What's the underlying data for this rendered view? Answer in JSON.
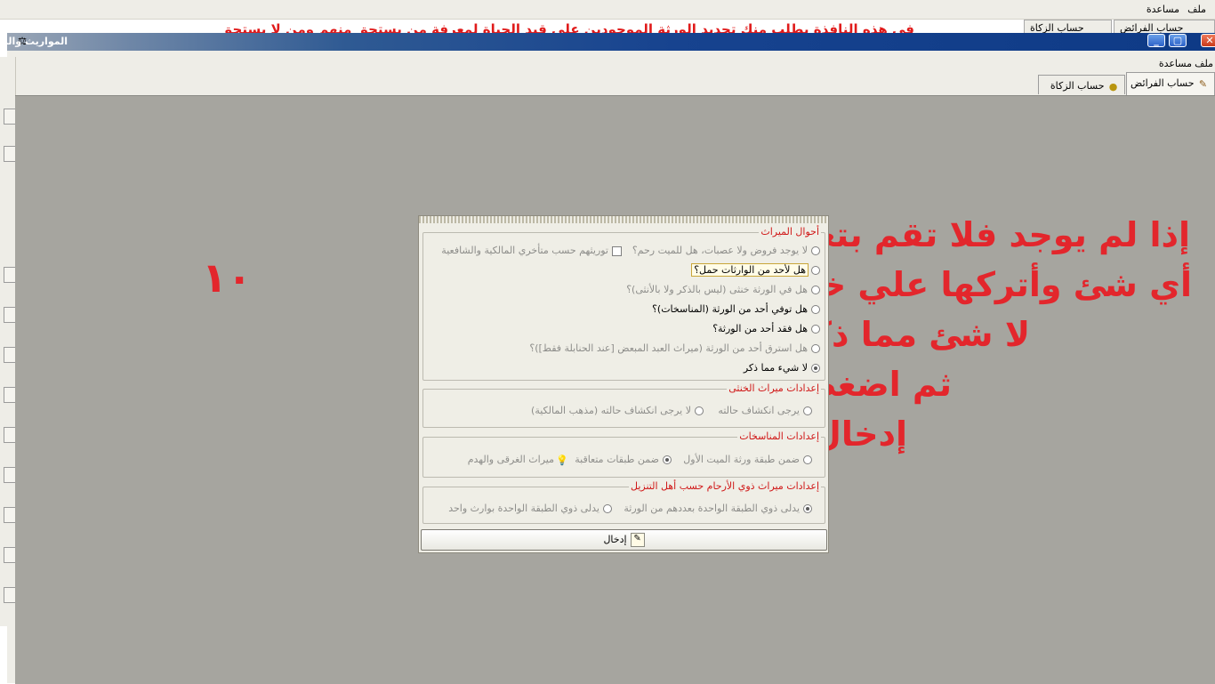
{
  "background_window": {
    "menu": {
      "file": "ملف",
      "help": "مساعدة"
    },
    "instruction_text": "في هذه النافذة يطلب منك تحديد الورثة الموجودين على قيد الحياة لمعرفة من يستحق منهم ومن لا يستحق",
    "tabs": {
      "fara": "حساب الفرائض",
      "zakat": "حساب الزكاة"
    }
  },
  "window": {
    "title": "المواريث والزكاة",
    "menu": {
      "file": "ملف",
      "help": "مساعدة"
    },
    "tabs": [
      {
        "label": "حساب الفرائض",
        "icon": "broom-icon",
        "active": true
      },
      {
        "label": "حساب الزكاة",
        "icon": "money-bag-icon",
        "active": false
      }
    ]
  },
  "annotation": {
    "step_number": "١٠",
    "lines": [
      "إذا لم يوجد فلا تقم بتعديل",
      "أي شئ وأتركها علي خير",
      "لا شئ مما ذكر",
      "ثم اضغط",
      "إدخال"
    ],
    "color": "#e3262c"
  },
  "dialog": {
    "heirs_group": {
      "legend": "أحوال الميراث",
      "options": [
        {
          "label": "لا يوجد فروض ولا عصبات، هل للميت رحم؟",
          "enabled": false,
          "selected": false
        },
        {
          "label": "هل لأحد من الوارثات حمل؟",
          "enabled": true,
          "selected": false,
          "focused": true
        },
        {
          "label": "هل في الورثة خنثى (ليس بالذكر ولا بالأنثى)؟",
          "enabled": false,
          "selected": false
        },
        {
          "label": "هل توفي أحد من الورثة (المناسخات)؟",
          "enabled": true,
          "selected": false
        },
        {
          "label": "هل فقد أحد من الورثة؟",
          "enabled": true,
          "selected": false
        },
        {
          "label": "هل استرق أحد من الورثة (ميراث العبد المبعض [عند الحنابلة فقط])؟",
          "enabled": false,
          "selected": false
        },
        {
          "label": "لا شيء مما ذكر",
          "enabled": true,
          "selected": true
        }
      ],
      "checkbox_label": "توريثهم حسب متأخري المالكية والشافعية"
    },
    "hermaphrodite_group": {
      "legend": "إعدادات ميراث الخنثى",
      "options": [
        "يرجى انكشاف حالته",
        "لا يرجى انكشاف حالته (مذهب المالكية)"
      ]
    },
    "munasakhat_group": {
      "legend": "إعدادات المناسخات",
      "options": [
        "ضمن طبقة ورثة الميت الأول",
        "ضمن طبقات متعاقبة"
      ],
      "selected_index": 1,
      "extra_label": "ميراث الغرقى والهدم",
      "extra_icon": "lightbulb-icon"
    },
    "arham_group": {
      "legend": "إعدادات ميراث ذوي الأرحام حسب أهل التنزيل",
      "options": [
        "يدلى ذوي الطبقة الواحدة بعددهم من الورثة",
        "يدلى ذوي الطبقة الواحدة بوارث واحد"
      ],
      "selected_index": 0
    },
    "enter_button": "إدخال"
  }
}
